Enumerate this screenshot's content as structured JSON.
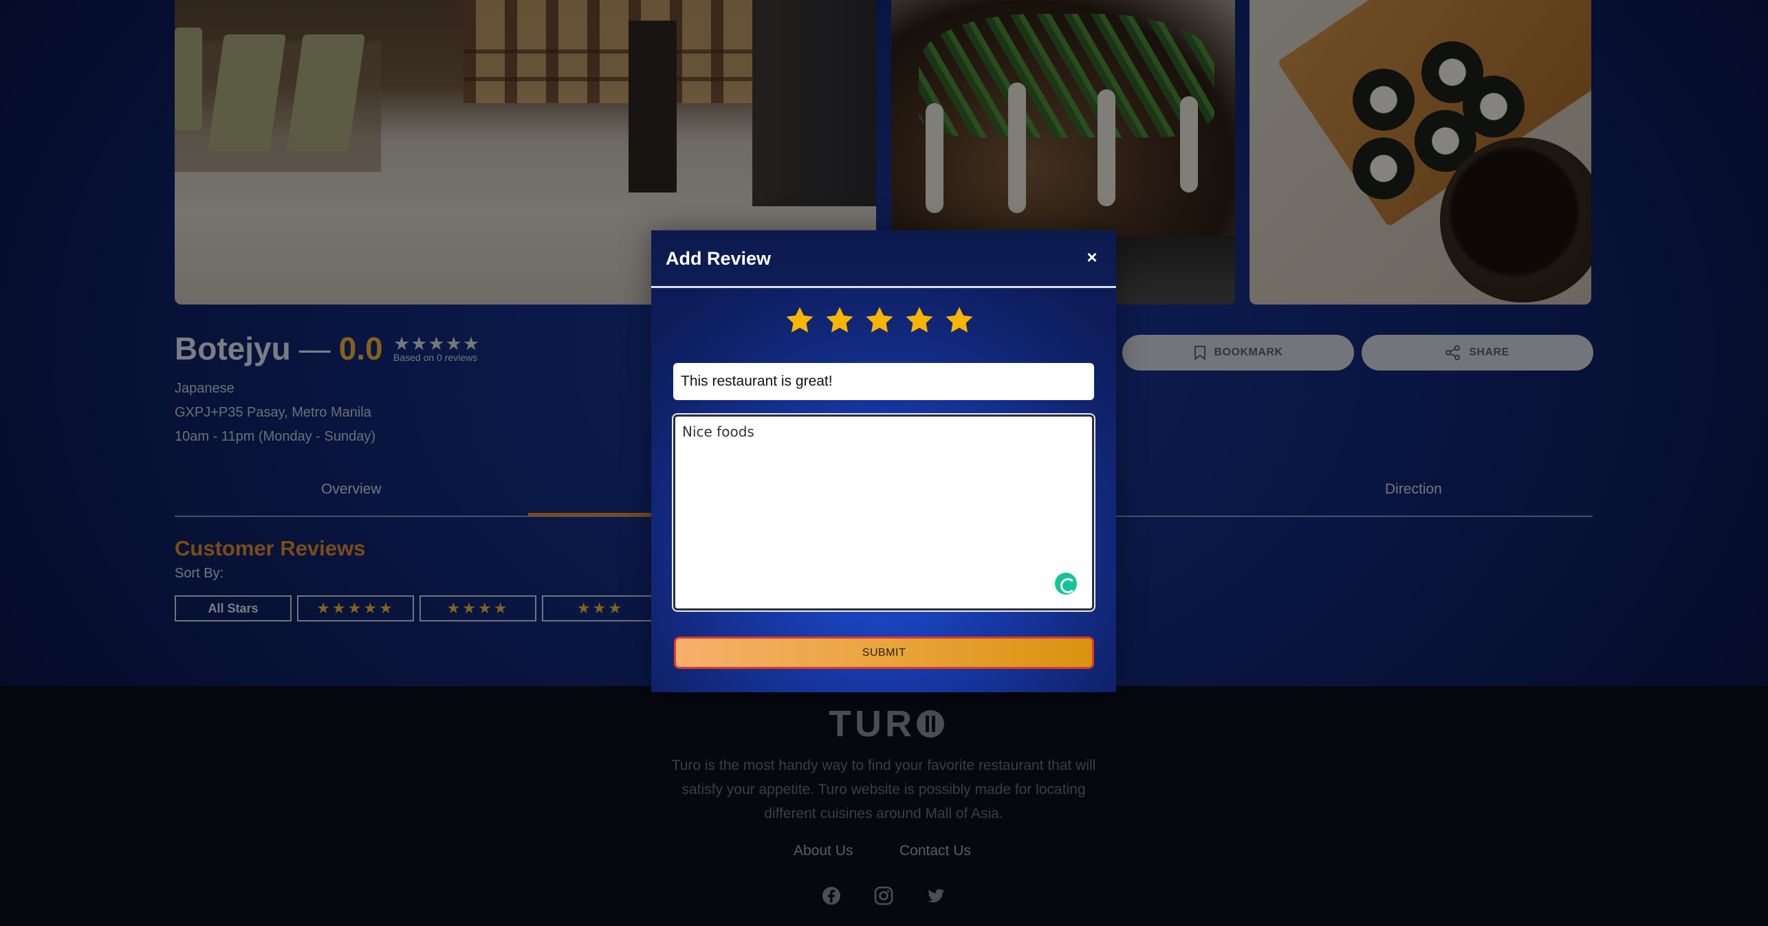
{
  "restaurant": {
    "name": "Botejyu",
    "dash": "—",
    "score": "0.0",
    "stars_display": "★★★★★",
    "based_on": "Based on 0 reviews",
    "cuisine": "Japanese",
    "address": "GXPJ+P35 Pasay, Metro Manila",
    "hours": "10am - 11pm (Monday - Sunday)"
  },
  "actions": {
    "bookmark_label": "BOOKMARK",
    "share_label": "SHARE"
  },
  "tabs": [
    {
      "label": "Overview"
    },
    {
      "label": "Direction"
    }
  ],
  "reviews": {
    "title": "Customer Reviews",
    "sort_by": "Sort By:",
    "filters": [
      {
        "label": "All Stars"
      },
      {
        "label": "★★★★★"
      },
      {
        "label": "★★★★"
      },
      {
        "label": "★★★"
      }
    ]
  },
  "modal": {
    "title": "Add Review",
    "close_symbol": "×",
    "rating": 5,
    "title_value": "This restaurant is great!",
    "body_value": "Nice foods",
    "submit_label": "SUBMIT"
  },
  "footer": {
    "logo_text": "TUR",
    "tagline": "Turo is the most handy way to find your favorite restaurant that will satisfy your appetite. Turo website is possibly made for locating different cuisines around Mall of Asia.",
    "links": [
      {
        "label": "About Us"
      },
      {
        "label": "Contact Us"
      }
    ],
    "social_icons": [
      "facebook-icon",
      "instagram-icon",
      "twitter-icon"
    ]
  },
  "colors": {
    "accent_orange": "#e08a2c",
    "score_gold": "#f3b234",
    "star_yellow": "#f7b500",
    "submit_border": "#e23a2a"
  }
}
